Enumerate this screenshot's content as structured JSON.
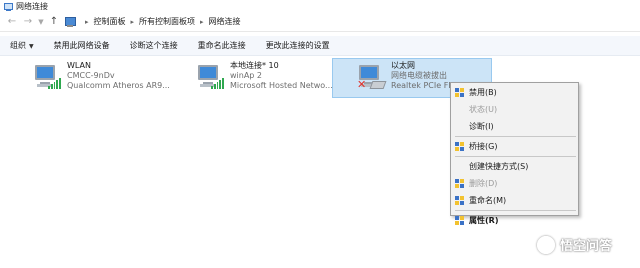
{
  "window": {
    "title": "网络连接"
  },
  "address": {
    "back_icon": "arrow-left-icon",
    "forward_icon": "arrow-right-icon",
    "up_icon": "arrow-up-icon",
    "breadcrumbs": [
      "控制面板",
      "所有控制面板项",
      "网络连接"
    ]
  },
  "toolbar": {
    "organize": "组织",
    "disable": "禁用此网络设备",
    "diagnose": "诊断这个连接",
    "rename": "重命名此连接",
    "change": "更改此连接的设置"
  },
  "adapters": [
    {
      "name": "WLAN",
      "status": "CMCC-9nDv",
      "device": "Qualcomm Atheros AR9..."
    },
    {
      "name": "本地连接* 10",
      "status": "winAp 2",
      "device": "Microsoft Hosted Netwo..."
    },
    {
      "name": "以太网",
      "status": "网络电缆被拔出",
      "device": "Realtek PCIe FE"
    }
  ],
  "context_menu": {
    "items": [
      {
        "label": "禁用(B)",
        "state": "enabled",
        "shield": true
      },
      {
        "label": "状态(U)",
        "state": "disabled",
        "shield": false
      },
      {
        "label": "诊断(I)",
        "state": "enabled",
        "shield": false
      },
      {
        "label": "桥接(G)",
        "state": "enabled",
        "shield": true
      },
      {
        "label": "创建快捷方式(S)",
        "state": "enabled",
        "shield": false
      },
      {
        "label": "删除(D)",
        "state": "disabled",
        "shield": true
      },
      {
        "label": "重命名(M)",
        "state": "enabled",
        "shield": true
      },
      {
        "label": "属性(R)",
        "state": "default",
        "shield": true
      }
    ]
  },
  "watermark": {
    "text": "悟空问答"
  },
  "colors": {
    "selection": "#cce4f7",
    "selection_border": "#99c9ef",
    "toolbar_bg": "#f4f7fc",
    "signal": "#2fa84f",
    "error_x": "#e0302a"
  }
}
